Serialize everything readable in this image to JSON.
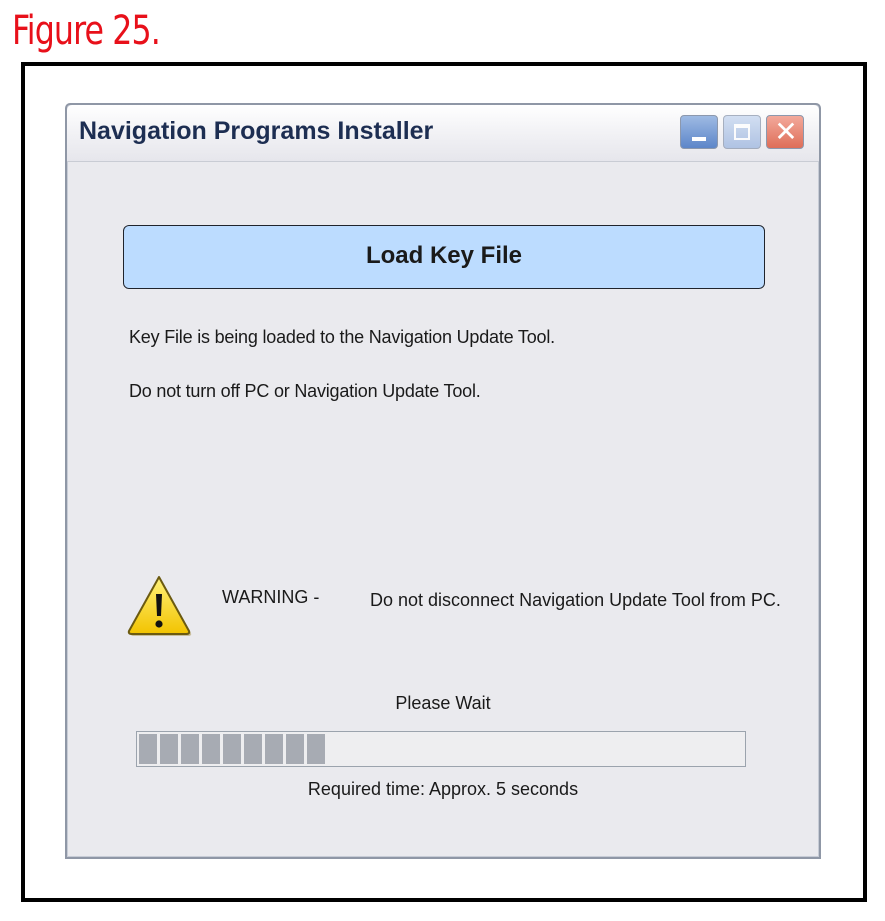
{
  "caption": {
    "text": "Figure 25.",
    "color": "#e8101a"
  },
  "window": {
    "title": "Navigation Programs Installer",
    "controls": {
      "minimize_icon": "minimize-icon",
      "maximize_icon": "maximize-icon",
      "close_icon": "close-icon",
      "close_glyph": "✕"
    }
  },
  "main": {
    "load_button_label": "Load Key File",
    "button_color": "#bcdcff",
    "status_line_1": "Key File is being loaded to the Navigation Update Tool.",
    "status_line_2": "Do not turn off PC or Navigation Update Tool.",
    "warning": {
      "icon": "warning-icon",
      "label": "WARNING -",
      "text": "Do not disconnect Navigation Update Tool from PC."
    },
    "progress": {
      "label": "Please Wait",
      "fraction": 0.32,
      "required_time": "Required time: Approx. 5 seconds"
    }
  }
}
